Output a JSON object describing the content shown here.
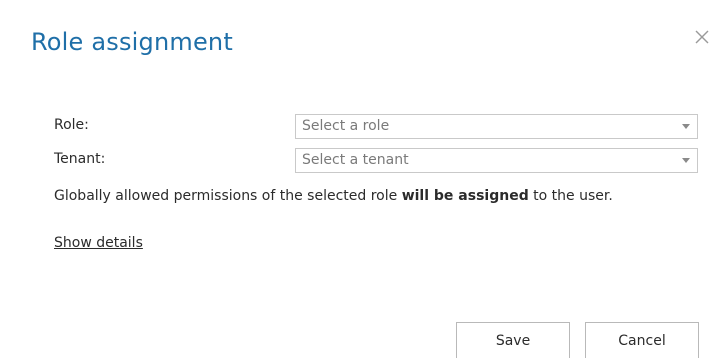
{
  "dialog": {
    "title": "Role assignment",
    "close_icon": "close-icon"
  },
  "form": {
    "role": {
      "label": "Role:",
      "placeholder": "Select a role"
    },
    "tenant": {
      "label": "Tenant:",
      "placeholder": "Select a tenant"
    }
  },
  "note": {
    "prefix": "Globally allowed permissions of the selected role ",
    "emphasis": "will be assigned",
    "suffix": " to the user."
  },
  "links": {
    "show_details": "Show details"
  },
  "buttons": {
    "save": "Save",
    "cancel": "Cancel"
  },
  "colors": {
    "title": "#1f6fa8",
    "text": "#2b2b2b",
    "placeholder": "#7a7a7a",
    "border": "#c9c9c9"
  }
}
